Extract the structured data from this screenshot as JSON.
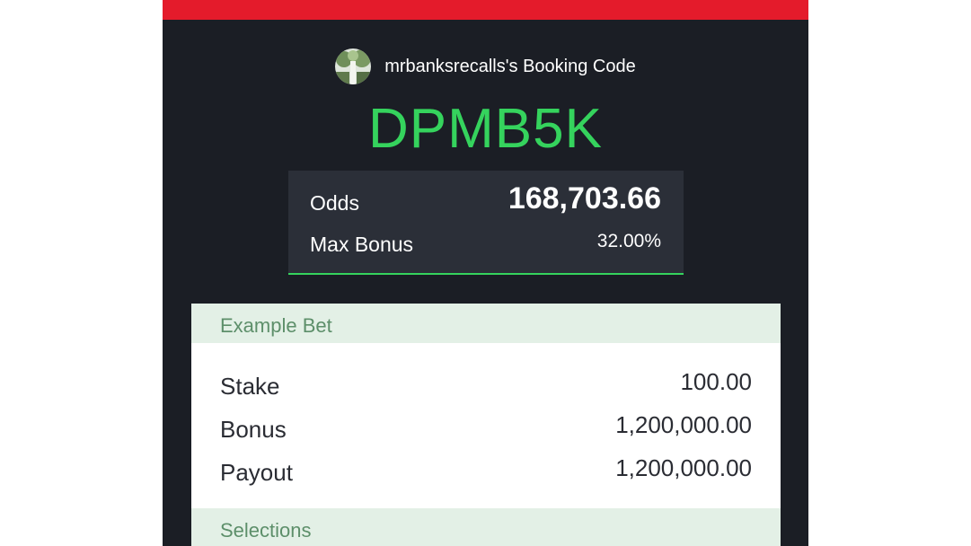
{
  "header": {
    "accent_color": "#e41b2b",
    "username_label": "mrbanksrecalls's Booking Code",
    "avatar": "user-avatar-photo"
  },
  "booking": {
    "code": "DPMB5K",
    "code_color": "#35d35d"
  },
  "summary": {
    "odds_label": "Odds",
    "odds_value": "168,703.66",
    "max_bonus_label": "Max Bonus",
    "max_bonus_value": "32.00%"
  },
  "example_bet": {
    "title": "Example Bet",
    "rows": [
      {
        "label": "Stake",
        "value": "100.00"
      },
      {
        "label": "Bonus",
        "value": "1,200,000.00"
      },
      {
        "label": "Payout",
        "value": "1,200,000.00"
      }
    ]
  },
  "selections": {
    "title": "Selections"
  }
}
